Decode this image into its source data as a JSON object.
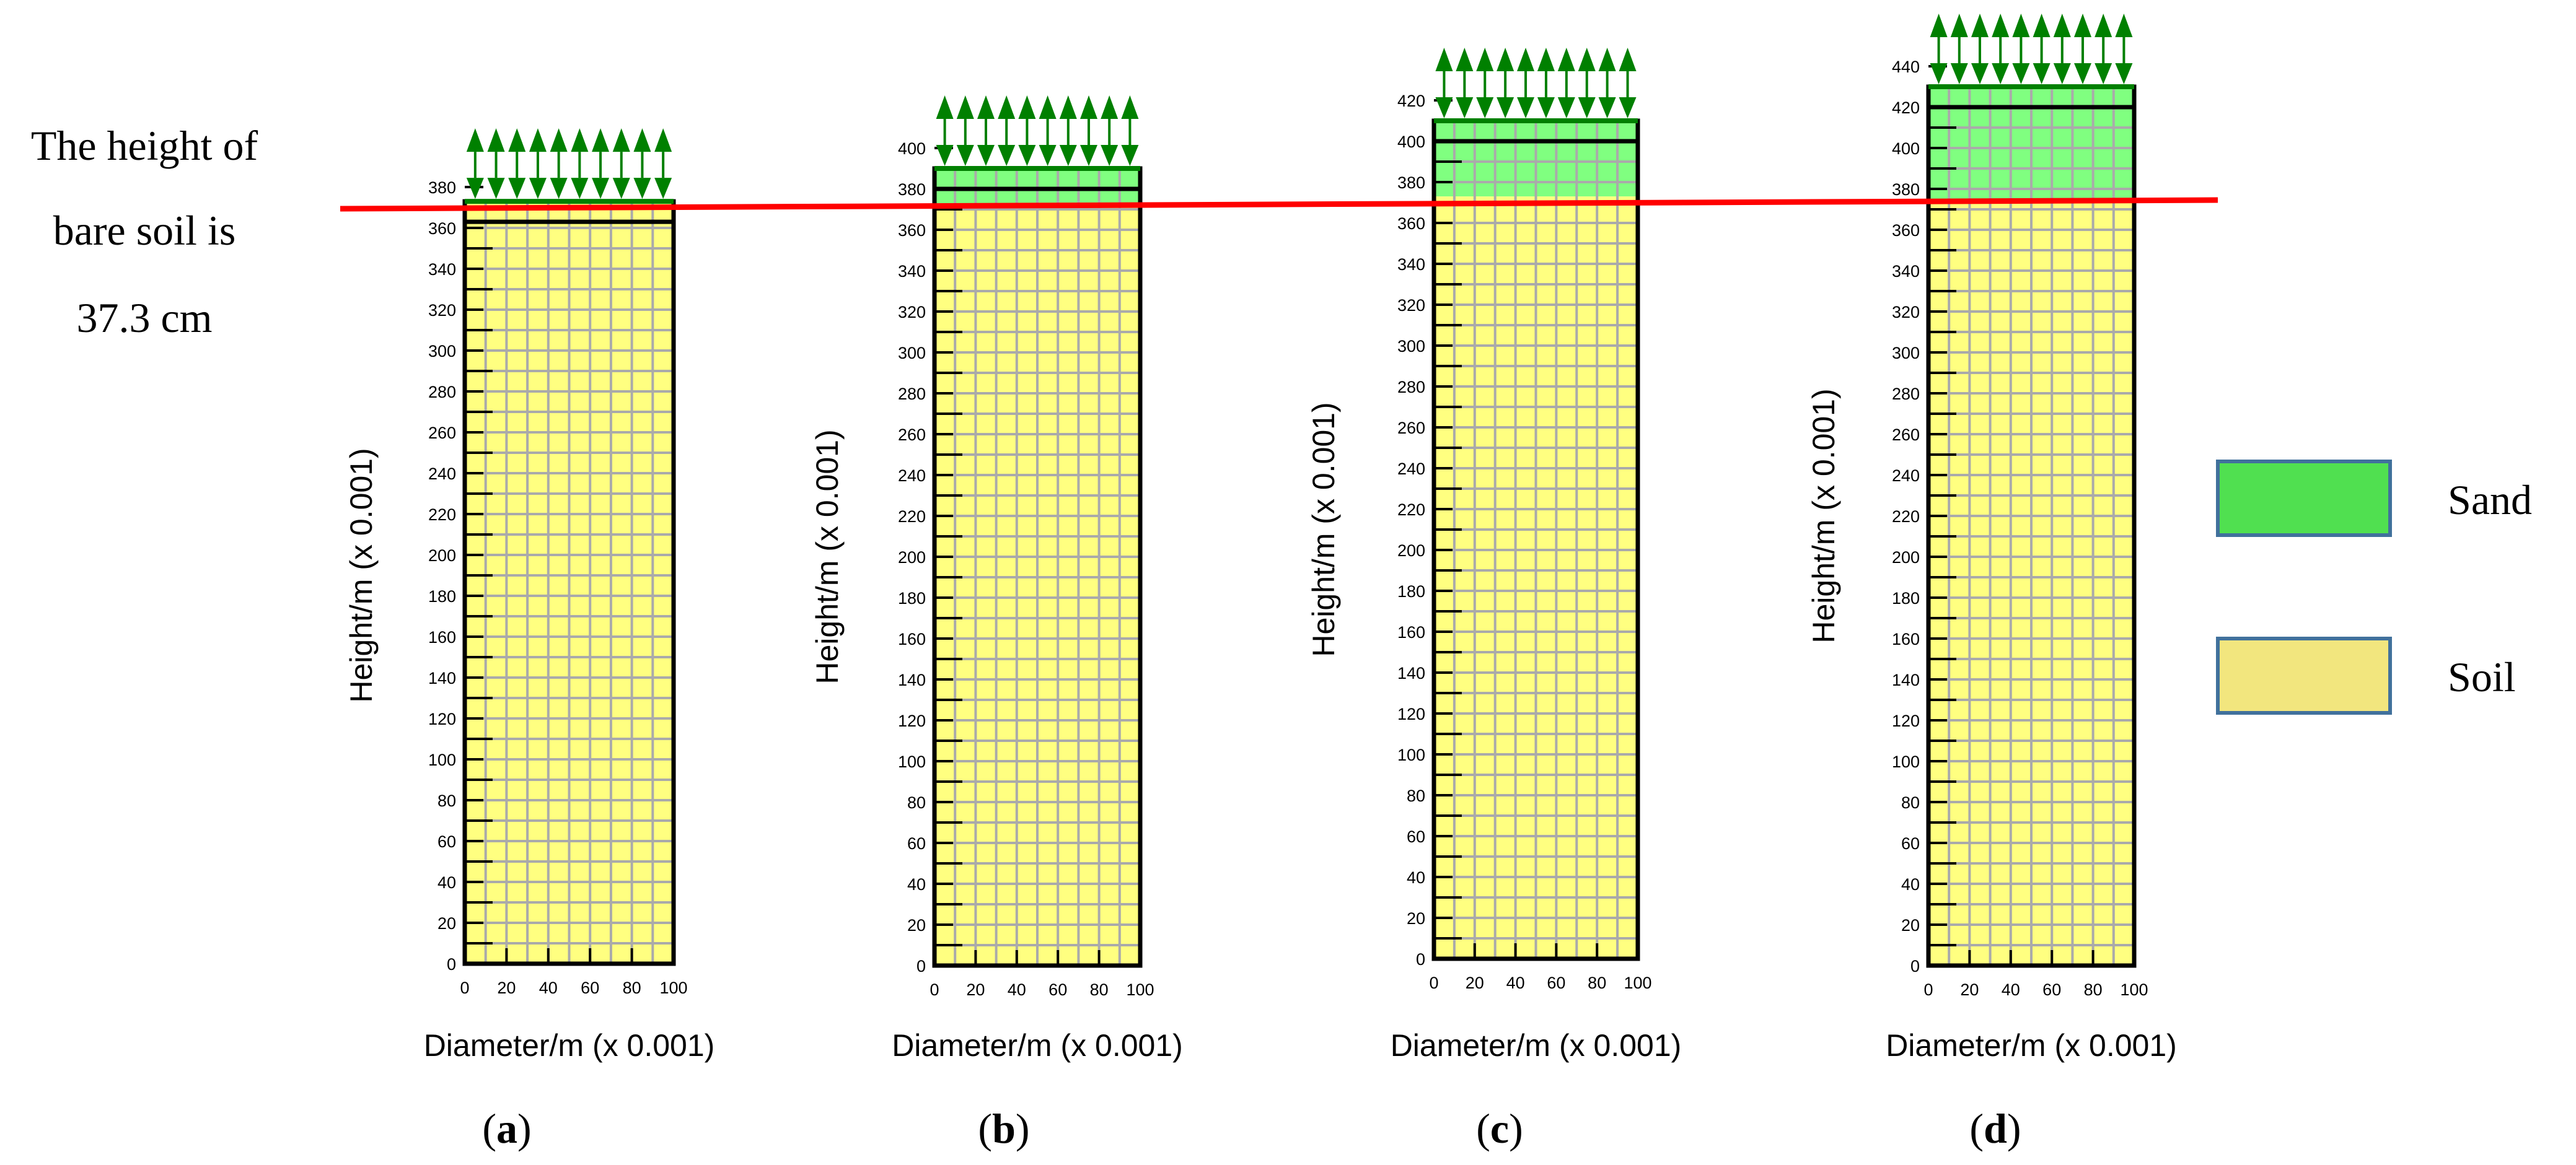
{
  "annotation": {
    "lines": [
      "The height of",
      "bare soil is",
      "37.3 cm"
    ],
    "reference_height": 373,
    "line_color": "#ff0000"
  },
  "legend": {
    "items": [
      {
        "label": "Sand",
        "color": "#50e050"
      },
      {
        "label": "Soil",
        "color": "#f2e67e"
      }
    ]
  },
  "colors": {
    "sand": "#80ff80",
    "soil": "#ffff80",
    "grid": "#aaaaaa",
    "load_arrows": "#008000"
  },
  "chart_data": [
    {
      "type": "area",
      "panel": "a",
      "xlabel": "Diameter/m (x 0.001)",
      "ylabel": "Height/m (x 0.001)",
      "xlim": [
        0,
        100
      ],
      "ylim": [
        0,
        380
      ],
      "xticks": [
        0,
        20,
        40,
        60,
        80,
        100
      ],
      "ytick_step": 20,
      "soil_top": 373,
      "sand_top": 373,
      "grid": true
    },
    {
      "type": "area",
      "panel": "b",
      "xlabel": "Diameter/m (x 0.001)",
      "ylabel": "Height/m (x 0.001)",
      "xlim": [
        0,
        100
      ],
      "ylim": [
        0,
        400
      ],
      "xticks": [
        0,
        20,
        40,
        60,
        80,
        100
      ],
      "ytick_step": 20,
      "soil_top": 373,
      "sand_top": 390,
      "grid": true
    },
    {
      "type": "area",
      "panel": "c",
      "xlabel": "Diameter/m (x 0.001)",
      "ylabel": "Height/m (x 0.001)",
      "xlim": [
        0,
        100
      ],
      "ylim": [
        0,
        420
      ],
      "xticks": [
        0,
        20,
        40,
        60,
        80,
        100
      ],
      "ytick_step": 20,
      "soil_top": 373,
      "sand_top": 410,
      "grid": true
    },
    {
      "type": "area",
      "panel": "d",
      "xlabel": "Diameter/m (x 0.001)",
      "ylabel": "Height/m (x 0.001)",
      "xlim": [
        0,
        100
      ],
      "ylim": [
        0,
        440
      ],
      "xticks": [
        0,
        20,
        40,
        60,
        80,
        100
      ],
      "ytick_step": 20,
      "soil_top": 373,
      "sand_top": 430,
      "grid": true
    }
  ]
}
